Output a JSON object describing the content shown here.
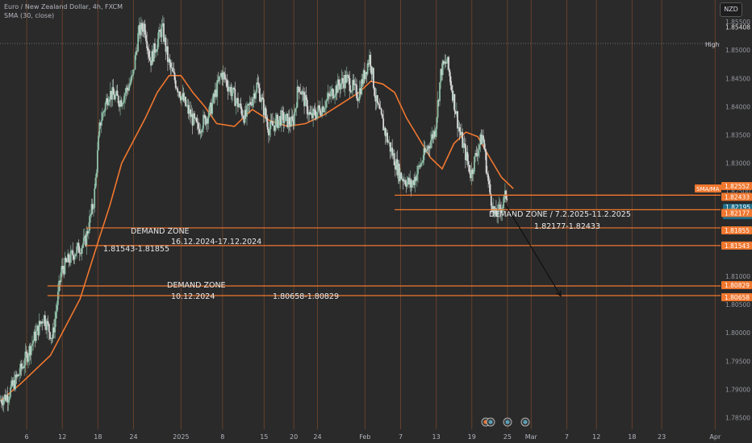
{
  "header": {
    "title": "Euro / New Zealand Dollar, 4h, FXCM",
    "indicator": "SMA (30, close)",
    "currency_button": "NZD"
  },
  "colors": {
    "background": "#2a2a2a",
    "grid": "#d4692a",
    "candle_up": "#8fbfa8",
    "candle_down": "#d8d8d8",
    "sma": "#f0772f",
    "zone": "#f0772f",
    "label_box": "#f0772f"
  },
  "chart_data": {
    "type": "candlestick",
    "timeframe": "4h",
    "symbol": "EURNZD",
    "ylim": [
      1.7835,
      1.858
    ],
    "yticks": [
      "1.85500",
      "1.85000",
      "1.84500",
      "1.84000",
      "1.83500",
      "1.83000",
      "1.82500",
      "1.81000",
      "1.80500",
      "1.80000",
      "1.79500",
      "1.79000",
      "1.78500"
    ],
    "xticks": [
      "6",
      "12",
      "18",
      "24",
      "2025",
      "8",
      "15",
      "20",
      "24",
      "Feb",
      "7",
      "13",
      "19",
      "25",
      "Mar",
      "7",
      "12",
      "18",
      "23",
      "Apr"
    ],
    "xtick_days": [
      6,
      12,
      18,
      24,
      32,
      39,
      46,
      51,
      55,
      63,
      69,
      75,
      81,
      87,
      91,
      97,
      102,
      108,
      113,
      122
    ],
    "x_range_days": [
      1.5,
      122.5
    ],
    "anchors": [
      [
        1.6,
        1.788
      ],
      [
        3,
        1.789
      ],
      [
        5,
        1.793
      ],
      [
        7,
        1.798
      ],
      [
        9,
        1.803
      ],
      [
        10.5,
        1.799
      ],
      [
        12,
        1.811
      ],
      [
        14,
        1.814
      ],
      [
        16,
        1.816
      ],
      [
        17.5,
        1.8235
      ],
      [
        18.5,
        1.837
      ],
      [
        20,
        1.8425
      ],
      [
        22,
        1.841
      ],
      [
        24,
        1.845
      ],
      [
        25,
        1.853
      ],
      [
        26,
        1.8545
      ],
      [
        27,
        1.848
      ],
      [
        28,
        1.851
      ],
      [
        29,
        1.854
      ],
      [
        30,
        1.848
      ],
      [
        31,
        1.845
      ],
      [
        33,
        1.84
      ],
      [
        35,
        1.836
      ],
      [
        37,
        1.839
      ],
      [
        39,
        1.846
      ],
      [
        41,
        1.842
      ],
      [
        43,
        1.838
      ],
      [
        45,
        1.844
      ],
      [
        47,
        1.836
      ],
      [
        49,
        1.838
      ],
      [
        51,
        1.837
      ],
      [
        52,
        1.844
      ],
      [
        54,
        1.838
      ],
      [
        56,
        1.84
      ],
      [
        58,
        1.843
      ],
      [
        60,
        1.845
      ],
      [
        62,
        1.842
      ],
      [
        64,
        1.849
      ],
      [
        65,
        1.841
      ],
      [
        67,
        1.834
      ],
      [
        69,
        1.828
      ],
      [
        71,
        1.826
      ],
      [
        73,
        1.831
      ],
      [
        75,
        1.836
      ],
      [
        76,
        1.8465
      ],
      [
        77,
        1.848
      ],
      [
        79,
        1.836
      ],
      [
        81,
        1.828
      ],
      [
        82,
        1.832
      ],
      [
        83,
        1.835
      ],
      [
        84,
        1.826
      ],
      [
        85,
        1.8205
      ],
      [
        86,
        1.822
      ],
      [
        87,
        1.8245
      ]
    ],
    "sma_30": [
      [
        1.6,
        1.788
      ],
      [
        5,
        1.791
      ],
      [
        10,
        1.796
      ],
      [
        15,
        1.806
      ],
      [
        18,
        1.816
      ],
      [
        20,
        1.8225
      ],
      [
        22,
        1.83
      ],
      [
        24,
        1.834
      ],
      [
        26,
        1.838
      ],
      [
        28,
        1.8425
      ],
      [
        30,
        1.8455
      ],
      [
        32,
        1.8455
      ],
      [
        34,
        1.8425
      ],
      [
        36,
        1.84
      ],
      [
        38,
        1.837
      ],
      [
        41,
        1.8365
      ],
      [
        44,
        1.8395
      ],
      [
        47,
        1.8375
      ],
      [
        50,
        1.8365
      ],
      [
        53,
        1.837
      ],
      [
        56,
        1.8385
      ],
      [
        59,
        1.8405
      ],
      [
        62,
        1.8425
      ],
      [
        64,
        1.8445
      ],
      [
        66,
        1.844
      ],
      [
        68,
        1.8425
      ],
      [
        70,
        1.838
      ],
      [
        72,
        1.8345
      ],
      [
        74,
        1.831
      ],
      [
        76,
        1.829
      ],
      [
        78,
        1.8335
      ],
      [
        80,
        1.8355
      ],
      [
        82,
        1.8347
      ],
      [
        84,
        1.831
      ],
      [
        86,
        1.8275
      ],
      [
        88,
        1.8255
      ]
    ],
    "demand_zones": [
      {
        "name": "DEMAND ZONE / 7.2.2025-11.2.2025",
        "range": "1.82177-1.82433",
        "low": 1.82177,
        "high": 1.82433,
        "start_day": 68
      },
      {
        "name": "DEMAND ZONE",
        "dates": "16.12.2024-17.12.2024",
        "range": "1.81543-1.81855",
        "low": 1.81543,
        "high": 1.81855,
        "start_day": 16
      },
      {
        "name": "DEMAND ZONE",
        "dates": "10.12.2024",
        "range": "1.80658-1.80829",
        "low": 1.80658,
        "high": 1.80829,
        "start_day": 9.5
      }
    ],
    "projection_arrow": {
      "from": [
        86.5,
        1.823
      ],
      "to": [
        96,
        1.8065
      ]
    },
    "high_marker": {
      "label": "High",
      "value": "1.85408"
    },
    "price_labels": [
      {
        "text": "1.85408",
        "value": 1.85408,
        "style": "plain"
      },
      {
        "text": "SMA/MA",
        "value": 1.82552,
        "style": "sma-tag"
      },
      {
        "text": "1.82552",
        "value": 1.82552,
        "style": "orange"
      },
      {
        "text": "1.82433",
        "value": 1.82433,
        "style": "orange"
      },
      {
        "text": "1.82195",
        "value": 1.82195,
        "style": "current"
      },
      {
        "text": "01:51:10",
        "value": 1.82195,
        "style": "countdown"
      },
      {
        "text": "1.82177",
        "value": 1.82177,
        "style": "orange"
      },
      {
        "text": "1.81855",
        "value": 1.81855,
        "style": "orange"
      },
      {
        "text": "1.81543",
        "value": 1.81543,
        "style": "orange"
      },
      {
        "text": "1.80829",
        "value": 1.80829,
        "style": "orange"
      },
      {
        "text": "1.80658",
        "value": 1.80658,
        "style": "orange"
      }
    ]
  }
}
